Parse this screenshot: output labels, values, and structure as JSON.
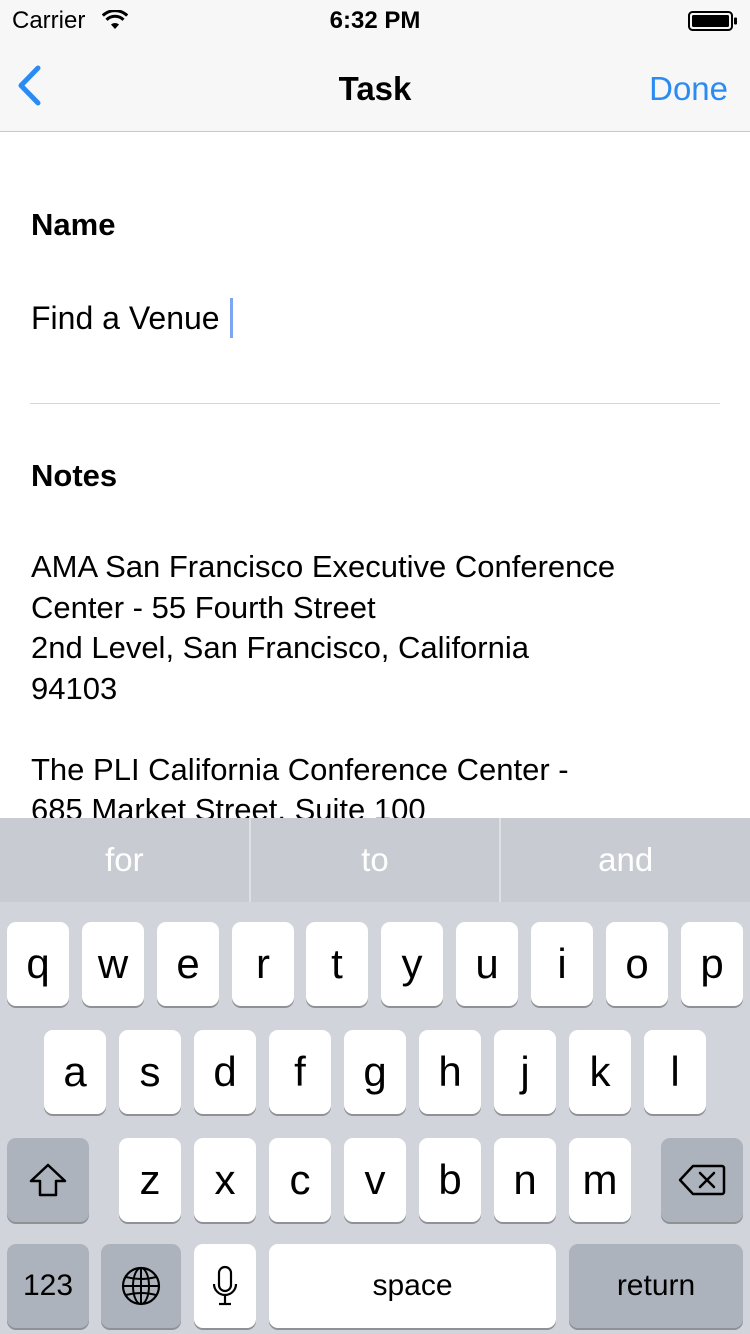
{
  "status_bar": {
    "carrier": "Carrier",
    "time": "6:32 PM"
  },
  "nav": {
    "title": "Task",
    "done_label": "Done",
    "back_icon": "chevron-left-icon"
  },
  "form": {
    "name_label": "Name",
    "name_value": "Find a Venue",
    "notes_label": "Notes",
    "notes_value": "AMA San Francisco Executive Conference\nCenter - 55 Fourth Street\n2nd Level, San Francisco, California\n94103\n\nThe PLI California Conference Center -\n685 Market Street, Suite 100"
  },
  "keyboard": {
    "suggestions": [
      "for",
      "to",
      "and"
    ],
    "row1": [
      "q",
      "w",
      "e",
      "r",
      "t",
      "y",
      "u",
      "i",
      "o",
      "p"
    ],
    "row2": [
      "a",
      "s",
      "d",
      "f",
      "g",
      "h",
      "j",
      "k",
      "l"
    ],
    "row3": [
      "z",
      "x",
      "c",
      "v",
      "b",
      "n",
      "m"
    ],
    "numbers_label": "123",
    "space_label": "space",
    "return_label": "return",
    "shift_icon": "shift-icon",
    "delete_icon": "delete-icon",
    "globe_icon": "globe-icon",
    "mic_icon": "microphone-icon"
  },
  "colors": {
    "accent": "#2a8bf2",
    "keyboard_bg": "#d1d5db",
    "dark_key": "#adb3bc"
  }
}
